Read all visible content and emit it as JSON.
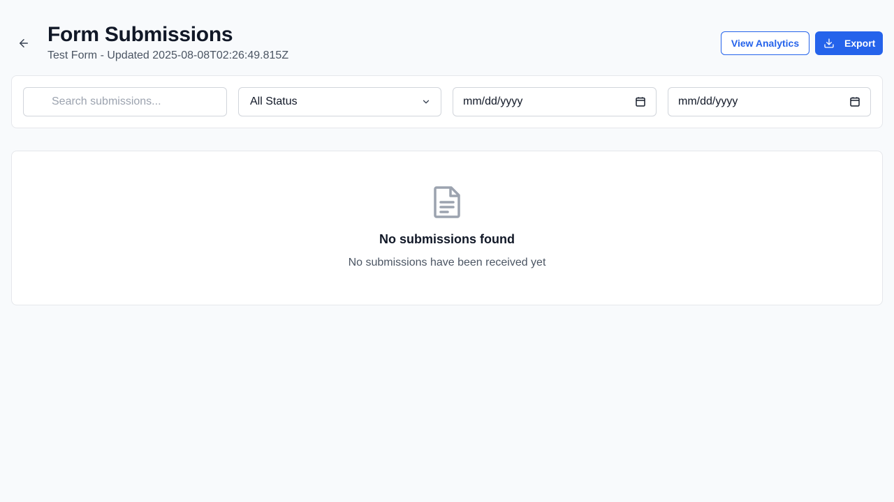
{
  "header": {
    "title": "Form Submissions",
    "subtitle": "Test Form - Updated 2025-08-08T02:26:49.815Z",
    "back_icon": "arrow-left-icon",
    "view_analytics_label": "View Analytics",
    "export_label": "Export",
    "export_icon": "download-icon"
  },
  "filters": {
    "search_placeholder": "Search submissions...",
    "status_value": "All Status",
    "date_from_value": "mm/dd/yyyy",
    "date_to_value": "mm/dd/yyyy"
  },
  "empty_state": {
    "icon": "document-icon",
    "title": "No submissions found",
    "description": "No submissions have been received yet"
  },
  "colors": {
    "accent": "#2563eb",
    "background": "#f8fafc"
  }
}
